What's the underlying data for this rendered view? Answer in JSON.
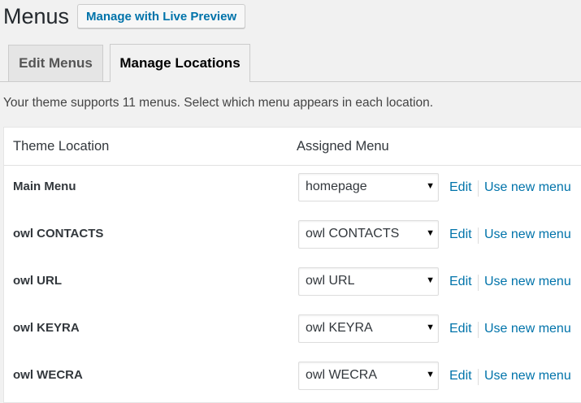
{
  "header": {
    "title": "Menus",
    "live_preview_label": "Manage with Live Preview"
  },
  "tabs": [
    {
      "label": "Edit Menus",
      "active": false
    },
    {
      "label": "Manage Locations",
      "active": true
    }
  ],
  "intro": "Your theme supports 11 menus. Select which menu appears in each location.",
  "table": {
    "columns": [
      "Theme Location",
      "Assigned Menu"
    ],
    "rows": [
      {
        "location": "Main Menu",
        "assigned": "homepage",
        "edit": "Edit",
        "new_menu": "Use new menu"
      },
      {
        "location": "owl CONTACTS",
        "assigned": "owl CONTACTS",
        "edit": "Edit",
        "new_menu": "Use new menu"
      },
      {
        "location": "owl URL",
        "assigned": "owl URL",
        "edit": "Edit",
        "new_menu": "Use new menu"
      },
      {
        "location": "owl KEYRA",
        "assigned": "owl KEYRA",
        "edit": "Edit",
        "new_menu": "Use new menu"
      },
      {
        "location": "owl WECRA",
        "assigned": "owl WECRA",
        "edit": "Edit",
        "new_menu": "Use new menu"
      }
    ]
  },
  "icons": {
    "dropdown": "chevron-down-icon"
  },
  "colors": {
    "link": "#0073aa",
    "background": "#f1f1f1",
    "panel": "#ffffff"
  }
}
